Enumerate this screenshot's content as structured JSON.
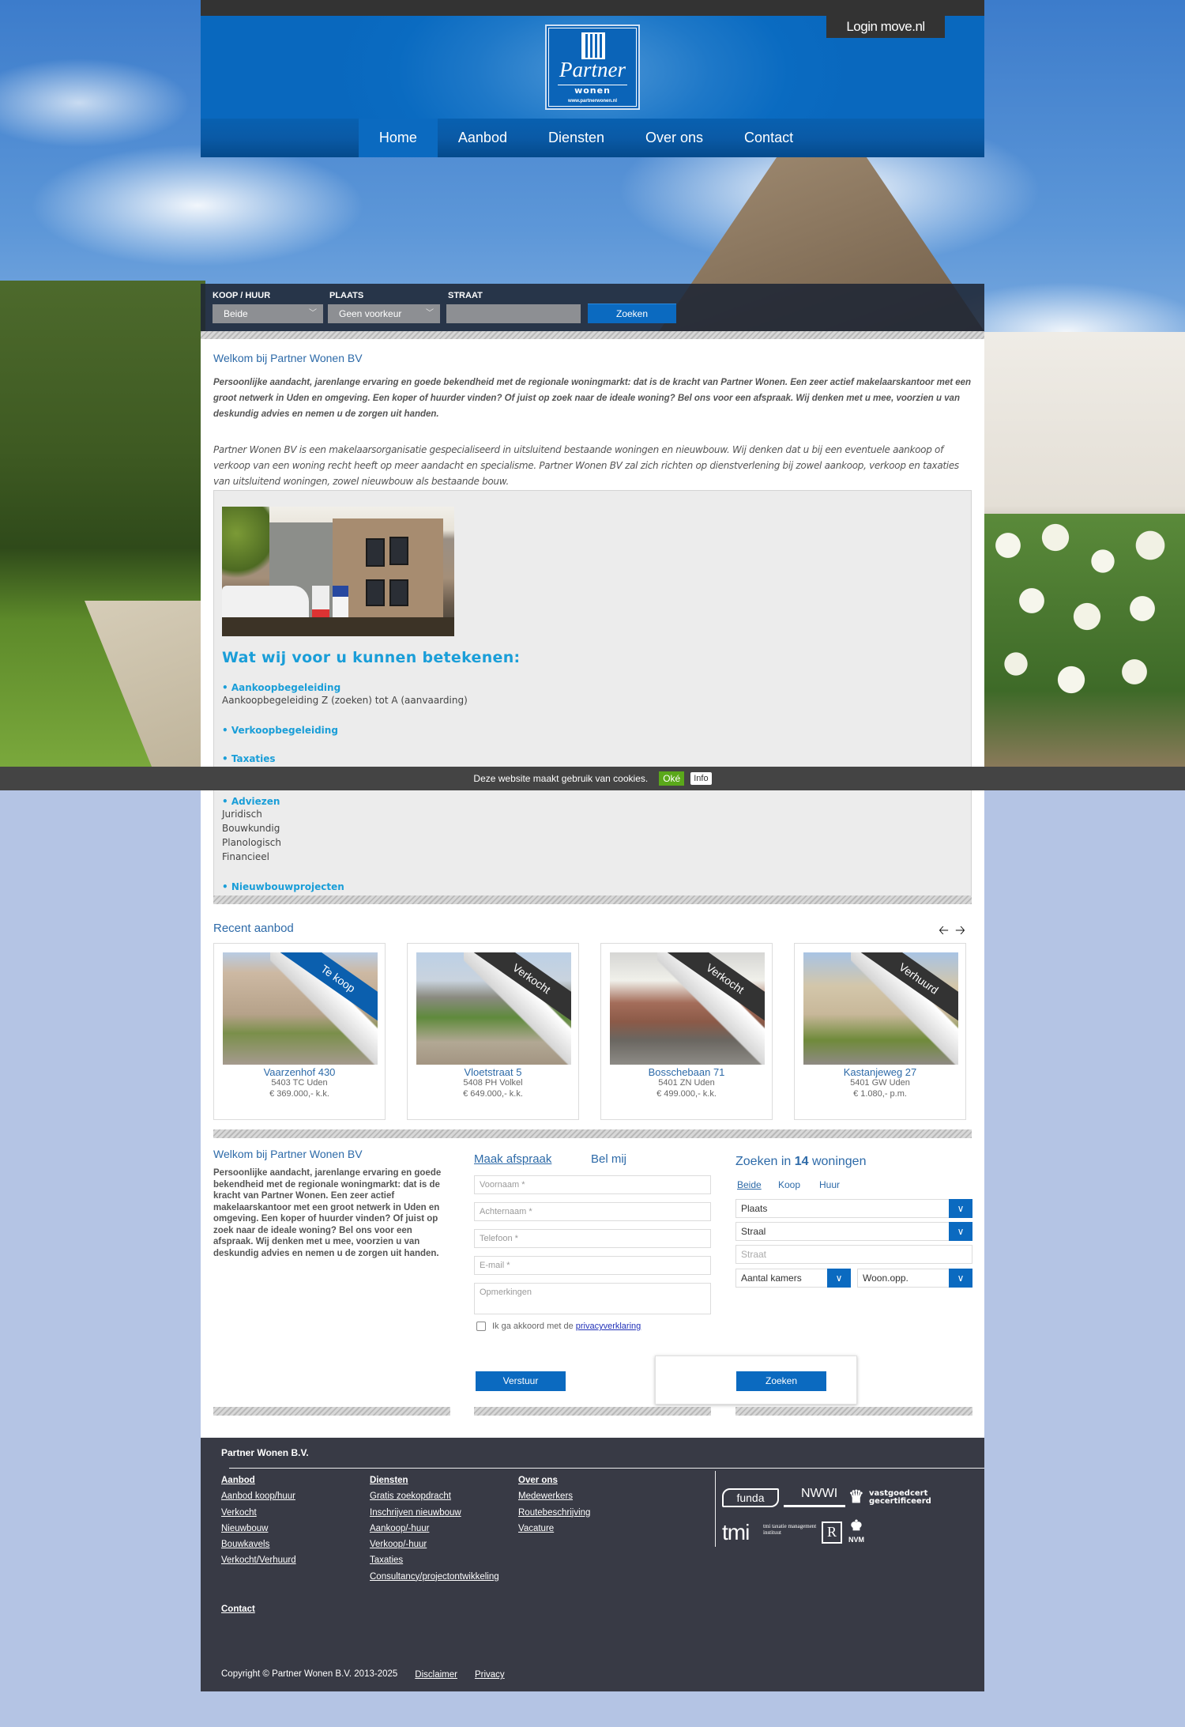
{
  "header": {
    "login_label": "Login move.nl",
    "logo": {
      "brand": "Partner",
      "sub": "wonen",
      "url_text": "www.partnerwonen.nl"
    },
    "colors": {
      "brand_blue": "#0b6ac0",
      "dark": "#333333",
      "footer": "#383a45",
      "page_bg": "#b4c4e4"
    }
  },
  "nav": {
    "items": [
      {
        "label": "Home",
        "active": true
      },
      {
        "label": "Aanbod",
        "active": false
      },
      {
        "label": "Diensten",
        "active": false
      },
      {
        "label": "Over ons",
        "active": false
      },
      {
        "label": "Contact",
        "active": false
      }
    ]
  },
  "quick_search": {
    "koop_huur_label": "KOOP / HUUR",
    "koop_huur_value": "Beide",
    "plaats_label": "PLAATS",
    "plaats_value": "Geen voorkeur",
    "straat_label": "STRAAT",
    "straat_value": "",
    "submit_label": "Zoeken"
  },
  "intro": {
    "title": "Welkom bij Partner Wonen BV",
    "paragraph1": "Persoonlijke aandacht, jarenlange ervaring en goede bekendheid met de regionale woningmarkt: dat is de kracht van Partner Wonen. Een zeer actief makelaarskantoor met een groot netwerk in Uden en omgeving. Een koper of huurder vinden? Of juist op zoek naar de ideale woning? Bel ons voor een afspraak. Wij denken met u mee, voorzien u van deskundig advies en nemen u de zorgen uit handen.",
    "paragraph2": "Partner Wonen BV is een makelaarsorganisatie gespecialiseerd in uitsluitend bestaande woningen en nieuwbouw. Wij denken dat u bij een eventuele aankoop of verkoop van een woning recht heeft op meer aandacht en specialisme. Partner Wonen BV zal zich richten op dienstverlening bij zowel aankoop, verkoop en taxaties van uitsluitend woningen, zowel nieuwbouw als bestaande bouw."
  },
  "services": {
    "heading": "Wat wij voor u kunnen betekenen:",
    "items": [
      {
        "title": "• Aankoopbegeleiding",
        "lines": [
          "Aankoopbegeleiding Z (zoeken) tot A (aanvaarding)"
        ]
      },
      {
        "title": "• Verkoopbegeleiding",
        "lines": []
      },
      {
        "title": "• Taxaties",
        "lines": []
      },
      {
        "title": "• Adviezen",
        "lines": [
          "Juridisch",
          "Bouwkundig",
          "Planologisch",
          "Financieel"
        ]
      },
      {
        "title": "• Nieuwbouwprojecten",
        "lines": []
      }
    ]
  },
  "cookie": {
    "text": "Deze website maakt gebruik van cookies.",
    "ok_label": "Oké",
    "info_label": "Info"
  },
  "recent": {
    "title": "Recent aanbod",
    "prev_icon": "arrow-left-icon",
    "next_icon": "arrow-right-icon",
    "listings": [
      {
        "status": "Te koop",
        "status_color": "#0b5fae",
        "street": "Vaarzenhof 430",
        "zip_city": "5403 TC Uden",
        "price": "€ 369.000,- k.k."
      },
      {
        "status": "Verkocht",
        "status_color": "#333333",
        "street": "Vloetstraat 5",
        "zip_city": "5408 PH Volkel",
        "price": "€ 649.000,- k.k."
      },
      {
        "status": "Verkocht",
        "status_color": "#333333",
        "street": "Bosschebaan 71",
        "zip_city": "5401 ZN Uden",
        "price": "€ 499.000,- k.k."
      },
      {
        "status": "Verhuurd",
        "status_color": "#333333",
        "street": "Kastanjeweg 27",
        "zip_city": "5401 GW Uden",
        "price": "€ 1.080,- p.m."
      }
    ]
  },
  "bottom": {
    "welcome_title": "Welkom bij Partner Wonen BV",
    "welcome_text": "Persoonlijke aandacht, jarenlange ervaring en goede bekendheid met de regionale woningmarkt: dat is de kracht van Partner Wonen. Een zeer actief makelaarskantoor met een groot netwerk in Uden en omgeving. Een koper of huurder vinden? Of juist op zoek naar de ideale woning? Bel ons voor een afspraak. Wij denken met u mee, voorzien u van deskundig advies en nemen u de zorgen uit handen.",
    "form": {
      "tab_afspraak": "Maak afspraak",
      "tab_belmij": "Bel mij",
      "voornaam_placeholder": "Voornaam *",
      "achternaam_placeholder": "Achternaam *",
      "telefoon_placeholder": "Telefoon *",
      "email_placeholder": "E-mail *",
      "opmerkingen_placeholder": "Opmerkingen",
      "privacy_text": "Ik ga akkoord met de",
      "privacy_link": "privacyverklaring",
      "privacy_checked": false,
      "submit_label": "Verstuur"
    },
    "search": {
      "title_prefix": "Zoeken in",
      "count": "14",
      "title_suffix": "woningen",
      "tabs": [
        {
          "label": "Beide",
          "active": true
        },
        {
          "label": "Koop",
          "active": false
        },
        {
          "label": "Huur",
          "active": false
        }
      ],
      "plaats_value": "Plaats",
      "straat_select_value": "Straal",
      "straat_placeholder": "Straat",
      "kamers_value": "Aantal kamers",
      "woonopp_value": "Woon.opp.",
      "submit_label": "Zoeken"
    }
  },
  "footer": {
    "company": "Partner Wonen B.V.",
    "columns": [
      {
        "heading": "Aanbod",
        "links": [
          "Aanbod koop/huur",
          "Verkocht",
          "Nieuwbouw",
          "Bouwkavels",
          "Verkocht/Verhuurd"
        ]
      },
      {
        "heading": "Diensten",
        "links": [
          "Gratis zoekopdracht",
          "Inschrijven nieuwbouw",
          "Aankoop/-huur",
          "Verkoop/-huur",
          "Taxaties",
          "Consultancy/projectontwikkeling"
        ]
      },
      {
        "heading": "Over ons",
        "links": [
          "Medewerkers",
          "Routebeschrijving",
          "Vacature"
        ]
      }
    ],
    "contact_label": "Contact",
    "partner_logos": [
      "funda",
      "NWWI",
      "vastgoedcert gecertificeerd",
      "tmi taxatie management instituut",
      "Register Taxateurs",
      "NVM"
    ],
    "copyright": "Copyright © Partner Wonen B.V. 2013-2025",
    "disclaimer_label": "Disclaimer",
    "privacy_label": "Privacy"
  }
}
